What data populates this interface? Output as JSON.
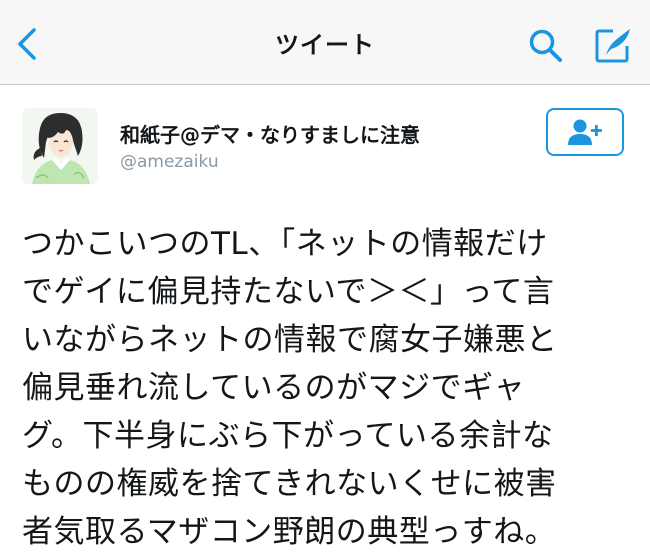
{
  "navbar": {
    "title": "ツイート",
    "accent_color": "#1b95e0",
    "back_icon": "chevron-left-icon",
    "search_icon": "search-icon",
    "compose_icon": "compose-tweet-icon"
  },
  "tweet": {
    "author": {
      "display_name": "和紙子@デマ・なりすましに注意",
      "handle": "@amezaiku",
      "avatar_icon": "avatar-illustration"
    },
    "follow_icon": "follow-user-plus-icon",
    "text": "つかこいつのTL、「ネットの情報だけ\nでゲイに偏見持たないで＞＜」って言\nいながらネットの情報で腐女子嫌悪と\n偏見垂れ流しているのがマジでギャ\nグ。下半身にぶら下がっている余計な\nものの権威を捨てきれないくせに被害\n者気取るマザコン野朗の典型っすね。"
  }
}
